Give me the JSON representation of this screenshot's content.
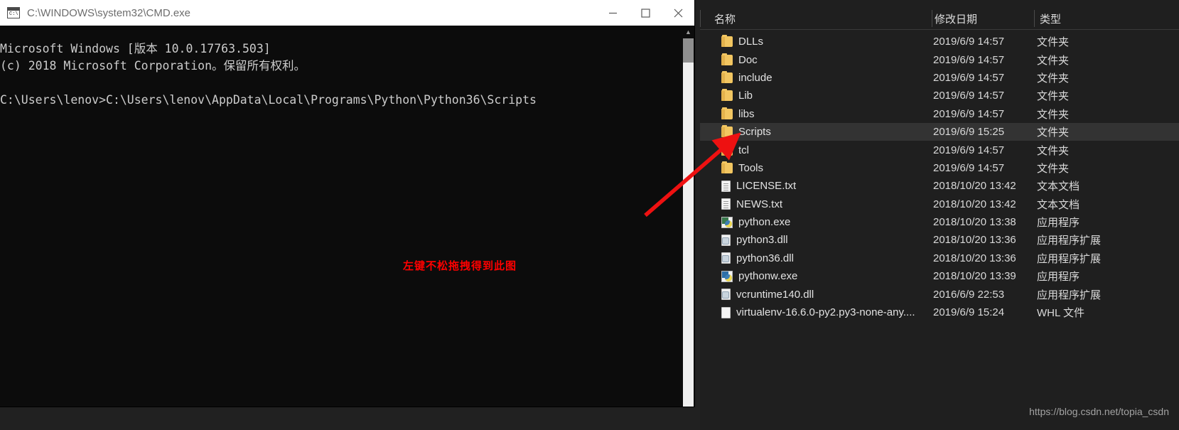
{
  "cmd_window": {
    "title": "C:\\WINDOWS\\system32\\CMD.exe",
    "icon": "cmd-icon",
    "icon_glyph": "C:\\",
    "minimize_label": "—",
    "maximize_label": "☐",
    "close_label": "✕",
    "console_text": "Microsoft Windows [版本 10.0.17763.503]\n(c) 2018 Microsoft Corporation。保留所有权利。\n\nC:\\Users\\lenov>C:\\Users\\lenov\\AppData\\Local\\Programs\\Python\\Python36\\Scripts",
    "annotation": "左键不松拖拽得到此图",
    "annotation_color": "#ff0000",
    "scroll_up_icon": "chevron-up-icon"
  },
  "explorer": {
    "columns": {
      "name": "名称",
      "date_modified": "修改日期",
      "type": "类型"
    },
    "sort_indicator": "⌃",
    "files": [
      {
        "name": "DLLs",
        "date": "2019/6/9 14:57",
        "type": "文件夹",
        "icon": "folder-icon",
        "selected": false
      },
      {
        "name": "Doc",
        "date": "2019/6/9 14:57",
        "type": "文件夹",
        "icon": "folder-icon",
        "selected": false
      },
      {
        "name": "include",
        "date": "2019/6/9 14:57",
        "type": "文件夹",
        "icon": "folder-icon",
        "selected": false
      },
      {
        "name": "Lib",
        "date": "2019/6/9 14:57",
        "type": "文件夹",
        "icon": "folder-icon",
        "selected": false
      },
      {
        "name": "libs",
        "date": "2019/6/9 14:57",
        "type": "文件夹",
        "icon": "folder-icon",
        "selected": false
      },
      {
        "name": "Scripts",
        "date": "2019/6/9 15:25",
        "type": "文件夹",
        "icon": "folder-icon",
        "selected": true
      },
      {
        "name": "tcl",
        "date": "2019/6/9 14:57",
        "type": "文件夹",
        "icon": "folder-icon",
        "selected": false
      },
      {
        "name": "Tools",
        "date": "2019/6/9 14:57",
        "type": "文件夹",
        "icon": "folder-icon",
        "selected": false
      },
      {
        "name": "LICENSE.txt",
        "date": "2018/10/20 13:42",
        "type": "文本文档",
        "icon": "text-file-icon",
        "selected": false
      },
      {
        "name": "NEWS.txt",
        "date": "2018/10/20 13:42",
        "type": "文本文档",
        "icon": "text-file-icon",
        "selected": false
      },
      {
        "name": "python.exe",
        "date": "2018/10/20 13:38",
        "type": "应用程序",
        "icon": "python-exe-icon",
        "selected": false
      },
      {
        "name": "python3.dll",
        "date": "2018/10/20 13:36",
        "type": "应用程序扩展",
        "icon": "dll-file-icon",
        "selected": false
      },
      {
        "name": "python36.dll",
        "date": "2018/10/20 13:36",
        "type": "应用程序扩展",
        "icon": "dll-file-icon",
        "selected": false
      },
      {
        "name": "pythonw.exe",
        "date": "2018/10/20 13:39",
        "type": "应用程序",
        "icon": "pythonw-exe-icon",
        "selected": false
      },
      {
        "name": "vcruntime140.dll",
        "date": "2016/6/9 22:53",
        "type": "应用程序扩展",
        "icon": "dll-file-icon",
        "selected": false
      },
      {
        "name": "virtualenv-16.6.0-py2.py3-none-any....",
        "date": "2019/6/9 15:24",
        "type": "WHL 文件",
        "icon": "whl-file-icon",
        "selected": false
      }
    ],
    "watermark": "https://blog.csdn.net/topia_csdn"
  },
  "colors": {
    "accent_red": "#ff0000",
    "folder_yellow": "#f2c661",
    "console_bg": "#0c0c0c",
    "explorer_bg": "#1f1f1f",
    "selection_bg": "#333333"
  }
}
